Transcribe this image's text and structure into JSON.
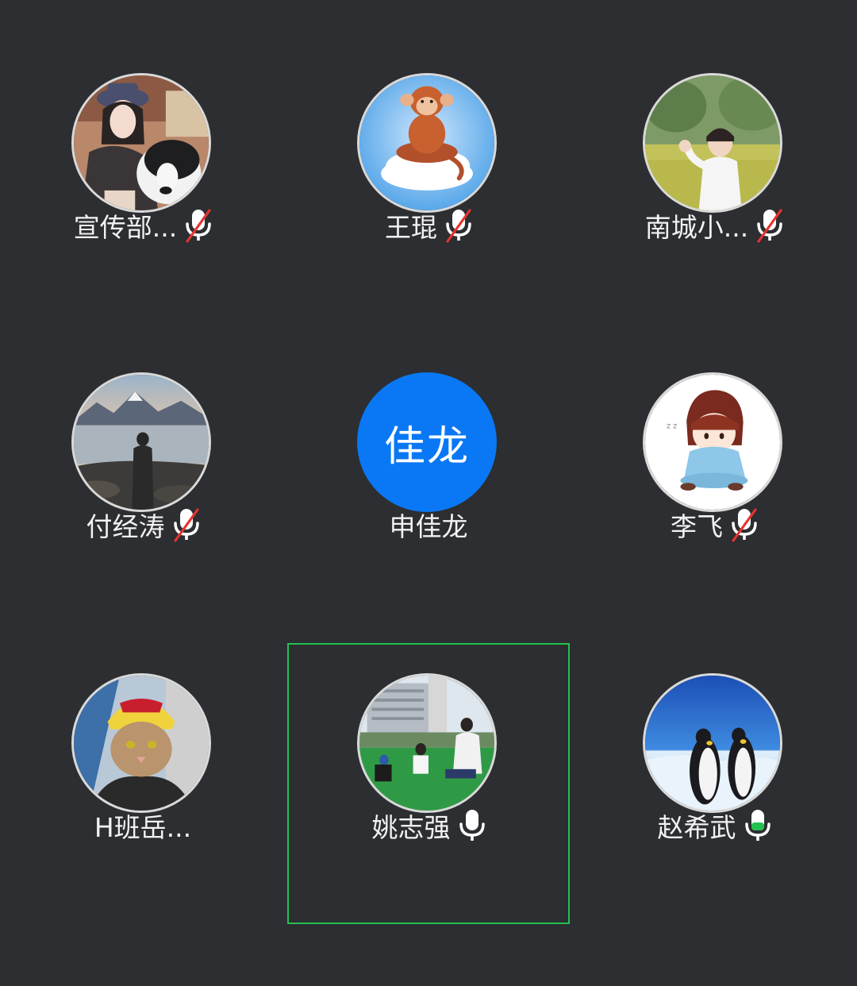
{
  "participants": [
    {
      "name": "宣传部...",
      "mic": "muted",
      "avatar_icon": "photo-girl-with-dog"
    },
    {
      "name": "王琨",
      "mic": "muted",
      "avatar_icon": "cartoon-monkey-on-cloud"
    },
    {
      "name": "南城小...",
      "mic": "muted",
      "avatar_icon": "photo-boy-in-field"
    },
    {
      "name": "付经涛",
      "mic": "muted",
      "avatar_icon": "photo-man-by-lake"
    },
    {
      "name": "申佳龙",
      "mic": "none",
      "avatar_text": "佳龙",
      "avatar_color": "#0a78f5"
    },
    {
      "name": "李飞",
      "mic": "muted",
      "avatar_icon": "anime-child-drawing"
    },
    {
      "name": "H班岳...",
      "mic": "none",
      "avatar_icon": "photo-cat-with-helmet"
    },
    {
      "name": "姚志强",
      "mic": "on",
      "avatar_icon": "photo-family-on-field",
      "speaking_highlight": "#23c150"
    },
    {
      "name": "赵希武",
      "mic": "speaking",
      "avatar_icon": "photo-penguins",
      "mic_level_color": "#23c150"
    }
  ],
  "colors": {
    "background": "#2c2e31",
    "muted_slash": "#e5342f",
    "speaking": "#23c150",
    "avatar_border": "#d9d9d9"
  }
}
